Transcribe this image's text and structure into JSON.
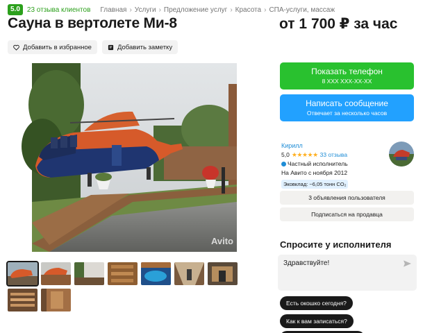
{
  "header": {
    "rating": "5.0",
    "reviews": "23 отзыва клиентов",
    "breadcrumbs": [
      "Главная",
      "Услуги",
      "Предложение услуг",
      "Красота",
      "СПА-услуги, массаж"
    ]
  },
  "listing": {
    "title": "Сауна в вертолете Ми-8",
    "price": "от 1 700 ₽ за час",
    "favorite_label": "Добавить в избранное",
    "note_label": "Добавить заметку",
    "watermark": "Avito"
  },
  "contact": {
    "phone_label": "Показать телефон",
    "phone_masked": "8 XXX XXX-XX-XX",
    "message_label": "Написать сообщение",
    "message_sub": "Отвечает за несколько часов"
  },
  "seller": {
    "name": "Кирилл",
    "rating": "5,0",
    "stars": "★★★★★",
    "reviews": "33 отзыва",
    "type": "Частный исполнитель",
    "since": "На Авито с ноября 2012",
    "eco": "Эковклад: −6,05 тонн CO₂",
    "listings_btn": "3 объявления пользователя",
    "subscribe_btn": "Подписаться на продавца"
  },
  "ask": {
    "title": "Спросите у исполнителя",
    "message": "Здравствуйте!",
    "quick_questions": [
      "Есть окошко сегодня?",
      "Как к вам записаться?"
    ]
  },
  "colors": {
    "green": "#29c12f",
    "blue": "#22a1ff",
    "badge": "#2ca01c",
    "link": "#1f8dd6"
  },
  "thumbnails_count": 9
}
